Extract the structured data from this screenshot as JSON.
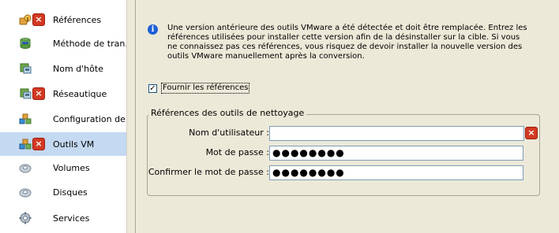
{
  "sidebar": {
    "items": [
      {
        "label": "Références",
        "icon": "references-icon",
        "error": true,
        "selected": false
      },
      {
        "label": "Méthode de tran...",
        "icon": "transfer-method-icon",
        "error": false,
        "selected": false
      },
      {
        "label": "Nom d'hôte",
        "icon": "hostname-icon",
        "error": false,
        "selected": false
      },
      {
        "label": "Réseautique",
        "icon": "network-icon",
        "error": true,
        "selected": false
      },
      {
        "label": "Configuration de...",
        "icon": "configuration-icon",
        "error": false,
        "selected": false
      },
      {
        "label": "Outils VM",
        "icon": "vm-tools-icon",
        "error": true,
        "selected": true
      },
      {
        "label": "Volumes",
        "icon": "volumes-icon",
        "error": false,
        "selected": false
      },
      {
        "label": "Disques",
        "icon": "disks-icon",
        "error": false,
        "selected": false
      },
      {
        "label": "Services",
        "icon": "services-icon",
        "error": false,
        "selected": false
      }
    ],
    "error_glyph": "×"
  },
  "main": {
    "info_glyph": "i",
    "info_text": "Une version antérieure des outils VMware a été détectée et doit être remplacée. Entrez les références utilisées pour installer cette version afin de la désinstaller sur la cible. Si vous ne connaissez pas ces références, vous risquez de devoir installer la nouvelle version des outils VMware manuellement après la conversion.",
    "checkbox": {
      "label": "Fournir les références",
      "checked": true,
      "glyph": "✓"
    },
    "group": {
      "legend": "Références des outils de nettoyage",
      "fields": [
        {
          "label": "Nom d'utilisateur :",
          "value": "",
          "error": true
        },
        {
          "label": "Mot de passe :",
          "value": "●●●●●●●●",
          "error": false
        },
        {
          "label": "Confirmer le mot de passe :",
          "value": "●●●●●●●●",
          "error": false
        }
      ]
    }
  },
  "colors": {
    "selection": "#c4d9f2",
    "error_red": "#d23a22",
    "info_blue": "#1e5fd6",
    "panel_bg": "#ece9d8"
  }
}
